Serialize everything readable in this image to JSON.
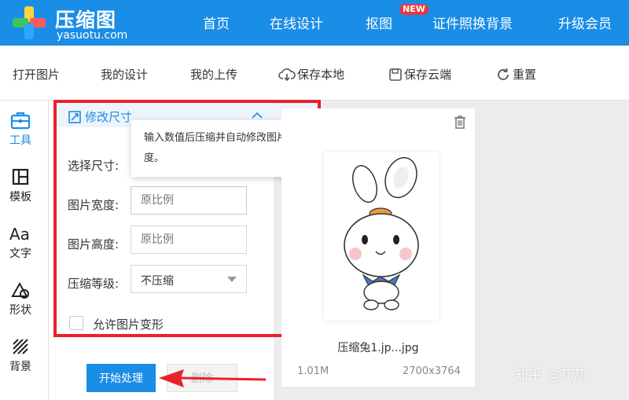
{
  "brand": {
    "name": "压缩图",
    "domain": "yasuotu.com"
  },
  "nav": {
    "items": [
      "首页",
      "在线设计",
      "抠图",
      "证件照换背景",
      "升级会员"
    ],
    "badge": "NEW"
  },
  "toolbar": {
    "open_image": "打开图片",
    "my_design": "我的设计",
    "my_upload": "我的上传",
    "save_local": "保存本地",
    "save_cloud": "保存云端",
    "reset": "重置"
  },
  "sidebar": {
    "items": [
      {
        "label": "工具",
        "icon": "toolbox-icon",
        "active": true
      },
      {
        "label": "模板",
        "icon": "template-icon",
        "active": false
      },
      {
        "label": "文字",
        "icon": "text-icon",
        "active": false
      },
      {
        "label": "形状",
        "icon": "shapes-icon",
        "active": false
      },
      {
        "label": "背景",
        "icon": "background-icon",
        "active": false
      }
    ]
  },
  "panel": {
    "title": "修改尺寸",
    "size_label": "选择尺寸:",
    "width_label": "图片宽度:",
    "width_placeholder": "原比例",
    "height_label": "图片高度:",
    "height_placeholder": "原比例",
    "compress_label": "压缩等级:",
    "compress_value": "不压缩",
    "allow_deform": "允许图片变形",
    "tooltip": "输入数值后压缩并自动修改图片宽度。"
  },
  "actions": {
    "start": "开始处理",
    "secondary": "删除"
  },
  "image": {
    "filename": "压缩兔1.jp...jpg",
    "filesize": "1.01M",
    "dimensions": "2700x3764"
  },
  "watermark": "知乎 @芃芃",
  "colors": {
    "primary": "#1a8de6",
    "annotation": "#e8222c",
    "badge": "#e8383d"
  }
}
